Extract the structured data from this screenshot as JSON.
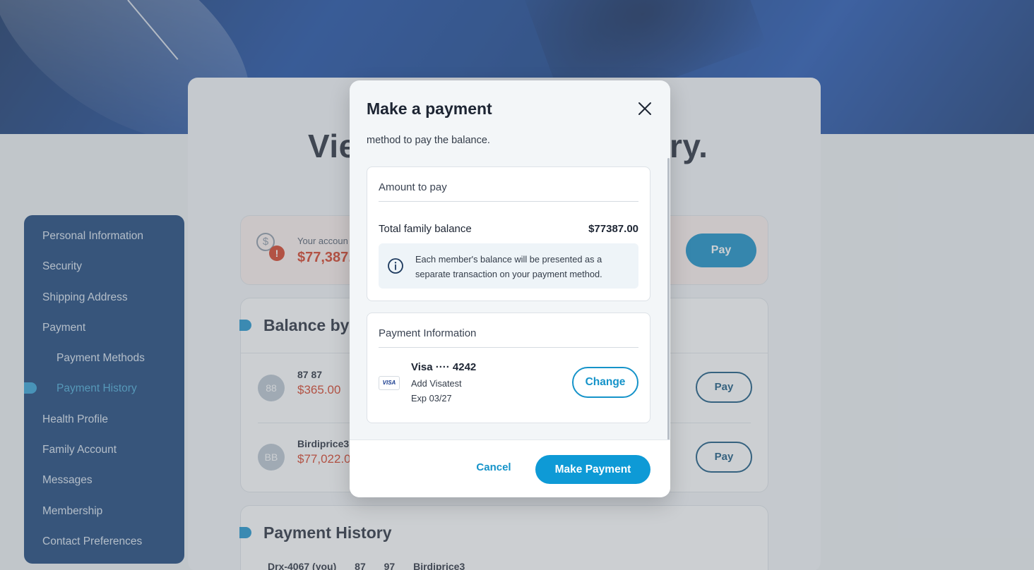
{
  "page": {
    "heading_left": "Vie",
    "heading_right": "ry."
  },
  "sidebar": {
    "items": [
      {
        "label": "Personal Information"
      },
      {
        "label": "Security"
      },
      {
        "label": "Shipping Address"
      },
      {
        "label": "Payment"
      },
      {
        "label": "Payment Methods"
      },
      {
        "label": "Payment History"
      },
      {
        "label": "Health Profile"
      },
      {
        "label": "Family Account"
      },
      {
        "label": "Messages"
      },
      {
        "label": "Membership"
      },
      {
        "label": "Contact Preferences"
      }
    ]
  },
  "alert": {
    "label": "Your accoun",
    "amount": "$77,387.0",
    "pay_label": "Pay"
  },
  "balance_section": {
    "title": "Balance by",
    "members": [
      {
        "initials": "88",
        "name": "87 87",
        "amount": "$365.00",
        "pay_label": "Pay"
      },
      {
        "initials": "BB",
        "name": "Birdiprice3",
        "amount": "$77,022.0",
        "pay_label": "Pay"
      }
    ]
  },
  "history_section": {
    "title": "Payment History",
    "columns": [
      "Drx-4067 (you)",
      "87",
      "97",
      "Birdiprice3"
    ]
  },
  "modal": {
    "title": "Make a payment",
    "intro": "method to pay the balance.",
    "amount_box": {
      "heading": "Amount to pay",
      "total_label": "Total family balance",
      "total_value": "$77387.00",
      "info": "Each member's balance will be presented as a separate transaction on your payment method."
    },
    "payment_box": {
      "heading": "Payment Information",
      "card_brand_badge": "VISA",
      "card_name": "Visa ···· 4242",
      "card_sub": "Add Visatest",
      "card_exp": "Exp 03/27",
      "change_label": "Change"
    },
    "cancel_label": "Cancel",
    "submit_label": "Make Payment"
  },
  "colors": {
    "accent": "#0e9ad6",
    "sidebar_bg": "#0f3b73",
    "amount_due": "#d6361b"
  }
}
